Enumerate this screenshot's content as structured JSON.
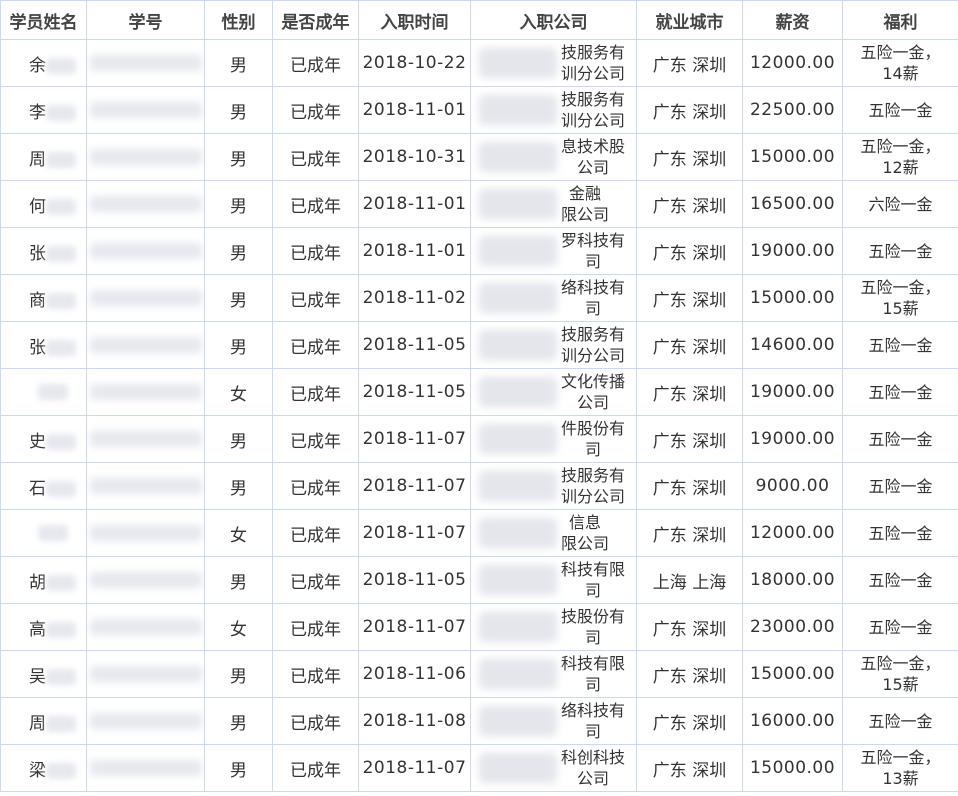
{
  "headers": [
    "学员姓名",
    "学号",
    "性别",
    "是否成年",
    "入职时间",
    "入职公司",
    "就业城市",
    "薪资",
    "福利"
  ],
  "rows": [
    {
      "name": "余",
      "gender": "男",
      "adult": "已成年",
      "date": "2018-10-22",
      "company": "技服务有\n训分公司",
      "city": "广东 深圳",
      "salary": "12000.00",
      "welfare": "五险一金，\n14薪"
    },
    {
      "name": "李",
      "gender": "男",
      "adult": "已成年",
      "date": "2018-11-01",
      "company": "技服务有\n训分公司",
      "city": "广东 深圳",
      "salary": "22500.00",
      "welfare": "五险一金"
    },
    {
      "name": "周",
      "gender": "男",
      "adult": "已成年",
      "date": "2018-10-31",
      "company": "息技术股\n公司",
      "city": "广东 深圳",
      "salary": "15000.00",
      "welfare": "五险一金，\n12薪"
    },
    {
      "name": "何",
      "gender": "男",
      "adult": "已成年",
      "date": "2018-11-01",
      "company": "金融\n限公司",
      "city": "广东 深圳",
      "salary": "16500.00",
      "welfare": "六险一金"
    },
    {
      "name": "张",
      "gender": "男",
      "adult": "已成年",
      "date": "2018-11-01",
      "company": "罗科技有\n司",
      "city": "广东 深圳",
      "salary": "19000.00",
      "welfare": "五险一金"
    },
    {
      "name": "商",
      "gender": "男",
      "adult": "已成年",
      "date": "2018-11-02",
      "company": "络科技有\n司",
      "city": "广东 深圳",
      "salary": "15000.00",
      "welfare": "五险一金，\n15薪"
    },
    {
      "name": "张",
      "gender": "男",
      "adult": "已成年",
      "date": "2018-11-05",
      "company": "技服务有\n训分公司",
      "city": "广东 深圳",
      "salary": "14600.00",
      "welfare": "五险一金"
    },
    {
      "name": "",
      "gender": "女",
      "adult": "已成年",
      "date": "2018-11-05",
      "company": "文化传播\n公司",
      "city": "广东 深圳",
      "salary": "19000.00",
      "welfare": "五险一金"
    },
    {
      "name": "史",
      "gender": "男",
      "adult": "已成年",
      "date": "2018-11-07",
      "company": "件股份有\n司",
      "city": "广东 深圳",
      "salary": "19000.00",
      "welfare": "五险一金"
    },
    {
      "name": "石",
      "gender": "男",
      "adult": "已成年",
      "date": "2018-11-07",
      "company": "技服务有\n训分公司",
      "city": "广东 深圳",
      "salary": "9000.00",
      "welfare": "五险一金"
    },
    {
      "name": "",
      "gender": "女",
      "adult": "已成年",
      "date": "2018-11-07",
      "company": "信息\n限公司",
      "city": "广东 深圳",
      "salary": "12000.00",
      "welfare": "五险一金"
    },
    {
      "name": "胡",
      "gender": "男",
      "adult": "已成年",
      "date": "2018-11-05",
      "company": "科技有限\n司",
      "city": "上海 上海",
      "salary": "18000.00",
      "welfare": "五险一金"
    },
    {
      "name": "高",
      "gender": "女",
      "adult": "已成年",
      "date": "2018-11-07",
      "company": "技股份有\n司",
      "city": "广东 深圳",
      "salary": "23000.00",
      "welfare": "五险一金"
    },
    {
      "name": "吴",
      "gender": "男",
      "adult": "已成年",
      "date": "2018-11-06",
      "company": "科技有限\n司",
      "city": "广东 深圳",
      "salary": "15000.00",
      "welfare": "五险一金，\n15薪"
    },
    {
      "name": "周",
      "gender": "男",
      "adult": "已成年",
      "date": "2018-11-08",
      "company": "络科技有\n司",
      "city": "广东 深圳",
      "salary": "16000.00",
      "welfare": "五险一金"
    },
    {
      "name": "梁",
      "gender": "男",
      "adult": "已成年",
      "date": "2018-11-07",
      "company": "科创科技\n公司",
      "city": "广东 深圳",
      "salary": "15000.00",
      "welfare": "五险一金，\n13薪"
    }
  ]
}
